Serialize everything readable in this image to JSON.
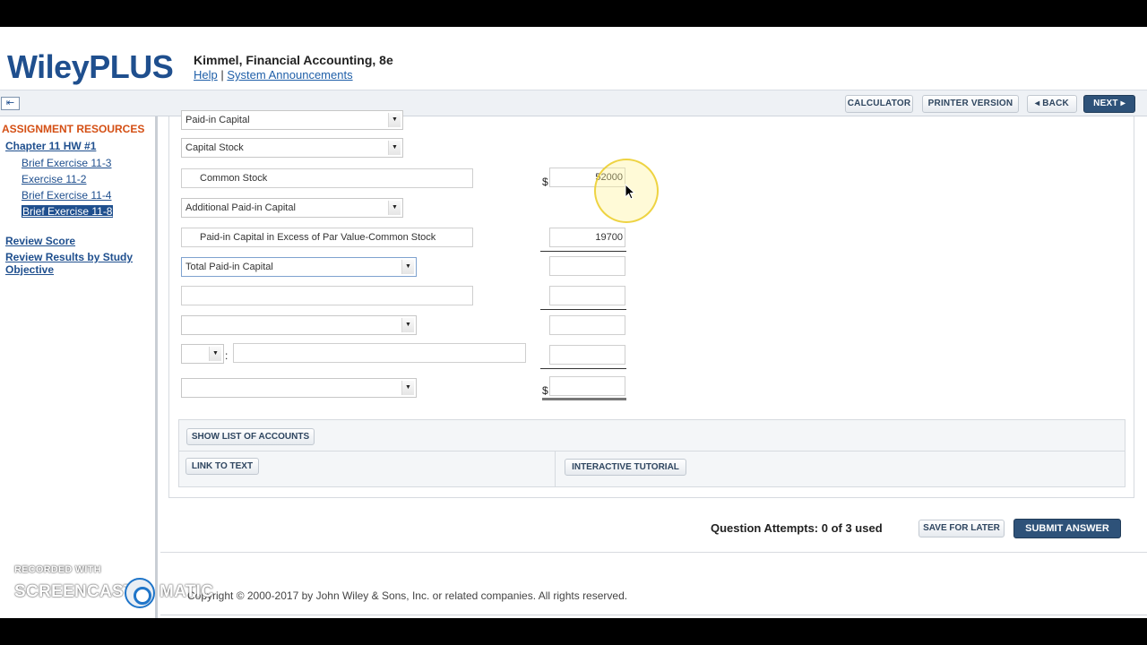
{
  "app": {
    "logo": "WileyPLUS",
    "book_title": "Kimmel, Financial Accounting, 8e",
    "help_link": "Help",
    "link_separator": "|",
    "announcements_link": "System Announcements"
  },
  "toolbar": {
    "collapse_icon": "⇤",
    "calculator": "CALCULATOR",
    "printer": "PRINTER VERSION",
    "back": "◂ BACK",
    "next": "NEXT ▸"
  },
  "sidebar": {
    "resources_title": "ASSIGNMENT RESOURCES",
    "chapter": "Chapter 11 HW #1",
    "items": [
      {
        "label": "Brief Exercise 11-3"
      },
      {
        "label": "Exercise 11-2"
      },
      {
        "label": "Brief Exercise 11-4"
      },
      {
        "label": "Brief Exercise 11-8"
      }
    ],
    "review_score": "Review Score",
    "review_results": "Review Results by Study Objective"
  },
  "form": {
    "row1_select": "Paid-in Capital",
    "row2_select": "Capital Stock",
    "row3_account": "Common Stock",
    "row3_dollar": "$",
    "row3_amount": "52000",
    "row4_select": "Additional Paid-in Capital",
    "row5_account": "Paid-in Capital in Excess of Par Value-Common Stock",
    "row5_amount": "19700",
    "row6_select": "Total Paid-in Capital",
    "row6_amount": "",
    "row7_account": "",
    "row7_amount": "",
    "row8_select": "",
    "row8_amount": "",
    "row9_small_select": "",
    "row9_colon": ":",
    "row9_text": "",
    "row9_amount": "",
    "row10_select": "",
    "row10_dollar": "$",
    "row10_amount": ""
  },
  "buttons": {
    "show_accounts": "SHOW LIST OF ACCOUNTS",
    "link_to_text": "LINK TO TEXT",
    "interactive_tutorial": "INTERACTIVE TUTORIAL"
  },
  "footer": {
    "attempts": "Question Attempts: 0 of 3 used",
    "save_for_later": "SAVE FOR LATER",
    "submit": "SUBMIT ANSWER",
    "copyright": "Copyright © 2000-2017 by John Wiley & Sons, Inc. or related companies. All rights reserved."
  },
  "watermark": {
    "line1": "RECORDED WITH",
    "line2a": "SCREENCAST",
    "line2b": "MATIC"
  }
}
